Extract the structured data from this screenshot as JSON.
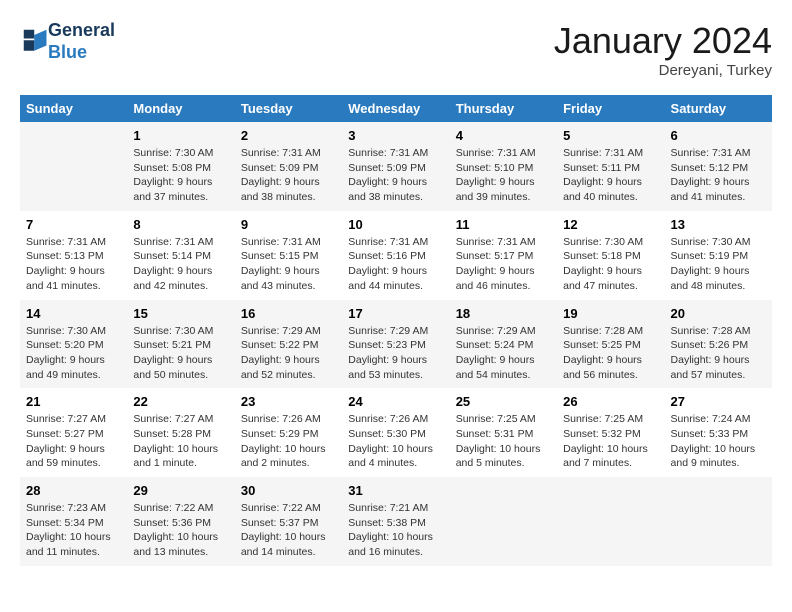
{
  "header": {
    "logo_line1": "General",
    "logo_line2": "Blue",
    "month_title": "January 2024",
    "subtitle": "Dereyani, Turkey"
  },
  "columns": [
    "Sunday",
    "Monday",
    "Tuesday",
    "Wednesday",
    "Thursday",
    "Friday",
    "Saturday"
  ],
  "weeks": [
    [
      {
        "day": "",
        "info": ""
      },
      {
        "day": "1",
        "info": "Sunrise: 7:30 AM\nSunset: 5:08 PM\nDaylight: 9 hours\nand 37 minutes."
      },
      {
        "day": "2",
        "info": "Sunrise: 7:31 AM\nSunset: 5:09 PM\nDaylight: 9 hours\nand 38 minutes."
      },
      {
        "day": "3",
        "info": "Sunrise: 7:31 AM\nSunset: 5:09 PM\nDaylight: 9 hours\nand 38 minutes."
      },
      {
        "day": "4",
        "info": "Sunrise: 7:31 AM\nSunset: 5:10 PM\nDaylight: 9 hours\nand 39 minutes."
      },
      {
        "day": "5",
        "info": "Sunrise: 7:31 AM\nSunset: 5:11 PM\nDaylight: 9 hours\nand 40 minutes."
      },
      {
        "day": "6",
        "info": "Sunrise: 7:31 AM\nSunset: 5:12 PM\nDaylight: 9 hours\nand 41 minutes."
      }
    ],
    [
      {
        "day": "7",
        "info": "Sunrise: 7:31 AM\nSunset: 5:13 PM\nDaylight: 9 hours\nand 41 minutes."
      },
      {
        "day": "8",
        "info": "Sunrise: 7:31 AM\nSunset: 5:14 PM\nDaylight: 9 hours\nand 42 minutes."
      },
      {
        "day": "9",
        "info": "Sunrise: 7:31 AM\nSunset: 5:15 PM\nDaylight: 9 hours\nand 43 minutes."
      },
      {
        "day": "10",
        "info": "Sunrise: 7:31 AM\nSunset: 5:16 PM\nDaylight: 9 hours\nand 44 minutes."
      },
      {
        "day": "11",
        "info": "Sunrise: 7:31 AM\nSunset: 5:17 PM\nDaylight: 9 hours\nand 46 minutes."
      },
      {
        "day": "12",
        "info": "Sunrise: 7:30 AM\nSunset: 5:18 PM\nDaylight: 9 hours\nand 47 minutes."
      },
      {
        "day": "13",
        "info": "Sunrise: 7:30 AM\nSunset: 5:19 PM\nDaylight: 9 hours\nand 48 minutes."
      }
    ],
    [
      {
        "day": "14",
        "info": "Sunrise: 7:30 AM\nSunset: 5:20 PM\nDaylight: 9 hours\nand 49 minutes."
      },
      {
        "day": "15",
        "info": "Sunrise: 7:30 AM\nSunset: 5:21 PM\nDaylight: 9 hours\nand 50 minutes."
      },
      {
        "day": "16",
        "info": "Sunrise: 7:29 AM\nSunset: 5:22 PM\nDaylight: 9 hours\nand 52 minutes."
      },
      {
        "day": "17",
        "info": "Sunrise: 7:29 AM\nSunset: 5:23 PM\nDaylight: 9 hours\nand 53 minutes."
      },
      {
        "day": "18",
        "info": "Sunrise: 7:29 AM\nSunset: 5:24 PM\nDaylight: 9 hours\nand 54 minutes."
      },
      {
        "day": "19",
        "info": "Sunrise: 7:28 AM\nSunset: 5:25 PM\nDaylight: 9 hours\nand 56 minutes."
      },
      {
        "day": "20",
        "info": "Sunrise: 7:28 AM\nSunset: 5:26 PM\nDaylight: 9 hours\nand 57 minutes."
      }
    ],
    [
      {
        "day": "21",
        "info": "Sunrise: 7:27 AM\nSunset: 5:27 PM\nDaylight: 9 hours\nand 59 minutes."
      },
      {
        "day": "22",
        "info": "Sunrise: 7:27 AM\nSunset: 5:28 PM\nDaylight: 10 hours\nand 1 minute."
      },
      {
        "day": "23",
        "info": "Sunrise: 7:26 AM\nSunset: 5:29 PM\nDaylight: 10 hours\nand 2 minutes."
      },
      {
        "day": "24",
        "info": "Sunrise: 7:26 AM\nSunset: 5:30 PM\nDaylight: 10 hours\nand 4 minutes."
      },
      {
        "day": "25",
        "info": "Sunrise: 7:25 AM\nSunset: 5:31 PM\nDaylight: 10 hours\nand 5 minutes."
      },
      {
        "day": "26",
        "info": "Sunrise: 7:25 AM\nSunset: 5:32 PM\nDaylight: 10 hours\nand 7 minutes."
      },
      {
        "day": "27",
        "info": "Sunrise: 7:24 AM\nSunset: 5:33 PM\nDaylight: 10 hours\nand 9 minutes."
      }
    ],
    [
      {
        "day": "28",
        "info": "Sunrise: 7:23 AM\nSunset: 5:34 PM\nDaylight: 10 hours\nand 11 minutes."
      },
      {
        "day": "29",
        "info": "Sunrise: 7:22 AM\nSunset: 5:36 PM\nDaylight: 10 hours\nand 13 minutes."
      },
      {
        "day": "30",
        "info": "Sunrise: 7:22 AM\nSunset: 5:37 PM\nDaylight: 10 hours\nand 14 minutes."
      },
      {
        "day": "31",
        "info": "Sunrise: 7:21 AM\nSunset: 5:38 PM\nDaylight: 10 hours\nand 16 minutes."
      },
      {
        "day": "",
        "info": ""
      },
      {
        "day": "",
        "info": ""
      },
      {
        "day": "",
        "info": ""
      }
    ]
  ]
}
